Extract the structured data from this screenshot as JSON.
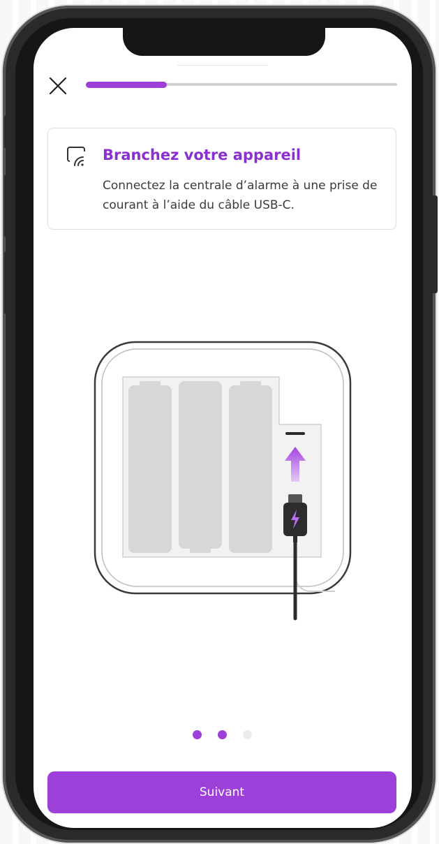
{
  "header": {
    "close_icon": "close-icon",
    "progress_fraction": 0.26
  },
  "card": {
    "icon": "cast-icon",
    "title": "Branchez votre appareil",
    "text": "Connectez la centrale d’alarme à une prise de courant à l’aide du câble USB-C."
  },
  "illustration": {
    "icon": "device-usb-c-plug-illustration"
  },
  "pagination": {
    "total": 3,
    "active": [
      0,
      1
    ]
  },
  "footer": {
    "next_label": "Suivant"
  },
  "colors": {
    "accent": "#9d3fd9",
    "title": "#8a2fd0",
    "track": "#cfcfcf"
  }
}
